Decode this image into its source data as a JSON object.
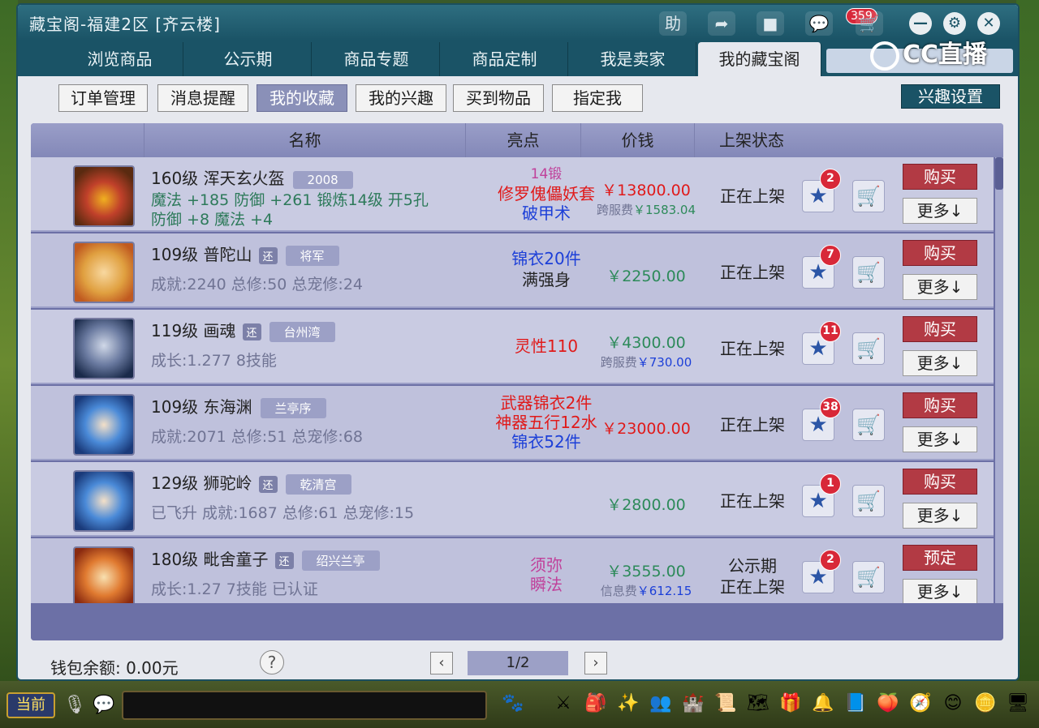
{
  "window": {
    "title": "藏宝阁-福建2区 [齐云楼]",
    "titlebar_buttons": [
      "助"
    ],
    "notification_count": "359"
  },
  "tabs": [
    {
      "label": "浏览商品"
    },
    {
      "label": "公示期"
    },
    {
      "label": "商品专题"
    },
    {
      "label": "商品定制"
    },
    {
      "label": "我是卖家"
    },
    {
      "label": "我的藏宝阁"
    }
  ],
  "overlay": {
    "cc_logo": "CC直播"
  },
  "subnav": [
    {
      "label": "订单管理"
    },
    {
      "label": "消息提醒"
    },
    {
      "label": "我的收藏"
    },
    {
      "label": "我的兴趣"
    },
    {
      "label": "买到物品"
    },
    {
      "label": "指定我"
    }
  ],
  "interest_settings": "兴趣设置",
  "table": {
    "headers": {
      "name": "名称",
      "highlight": "亮点",
      "price": "价钱",
      "status": "上架状态"
    },
    "rows": [
      {
        "title": "160级  浑天玄火盔",
        "tag": "2008",
        "detail1": "魔法 +185 防御 +261 锻炼14级 开5孔",
        "detail2": "防御 +8 魔法 +4",
        "hl1": "14锻",
        "hl2": "修罗傀儡妖套",
        "hl3": "破甲术",
        "price": "￥13800.00",
        "fee_label": "跨服费",
        "fee_amount": "￥1583.04",
        "status": "正在上架",
        "fav_count": "2",
        "buy": "购买",
        "more": "更多↓"
      },
      {
        "title": "109级  普陀山",
        "huan": "还",
        "tag": "将军",
        "detail1": "成就:2240 总修:50 总宠修:24",
        "hl1": "锦衣20件",
        "hl2": "满强身",
        "price": "￥2250.00",
        "status": "正在上架",
        "fav_count": "7",
        "buy": "购买",
        "more": "更多↓"
      },
      {
        "title": "119级  画魂",
        "huan": "还",
        "tag": "台州湾",
        "detail1": "成长:1.277 8技能",
        "hl1": "灵性110",
        "price": "￥4300.00",
        "fee_label": "跨服费",
        "fee_amount": "￥730.00",
        "status": "正在上架",
        "fav_count": "11",
        "buy": "购买",
        "more": "更多↓"
      },
      {
        "title": "109级  东海渊",
        "tag": "兰亭序",
        "detail1": "成就:2071 总修:51 总宠修:68",
        "hl1": "武器锦衣2件",
        "hl2": "神器五行12水",
        "hl3": "锦衣52件",
        "price": "￥23000.00",
        "status": "正在上架",
        "fav_count": "38",
        "buy": "购买",
        "more": "更多↓"
      },
      {
        "title": "129级  狮驼岭",
        "huan": "还",
        "tag": "乾清宫",
        "detail1": "已飞升 成就:1687 总修:61 总宠修:15",
        "price": "￥2800.00",
        "status": "正在上架",
        "fav_count": "1",
        "buy": "购买",
        "more": "更多↓"
      },
      {
        "title": "180级  毗舍童子",
        "huan": "还",
        "tag": "绍兴兰亭",
        "detail1": "成长:1.27 7技能 已认证",
        "hl1": "须弥",
        "hl2": "瞬法",
        "price": "￥3555.00",
        "fee_label": "信息费",
        "fee_amount": "￥612.15",
        "status1": "公示期",
        "status2": "正在上架",
        "fav_count": "2",
        "buy": "预定",
        "more": "更多↓"
      }
    ]
  },
  "footer": {
    "wallet": "钱包余额: 0.00元",
    "page": "1/2"
  },
  "bottom": {
    "current": "当前"
  },
  "colors": {
    "accent": "#1a5366",
    "table_bg": "#6c70a6",
    "buy": "#b23a44"
  }
}
